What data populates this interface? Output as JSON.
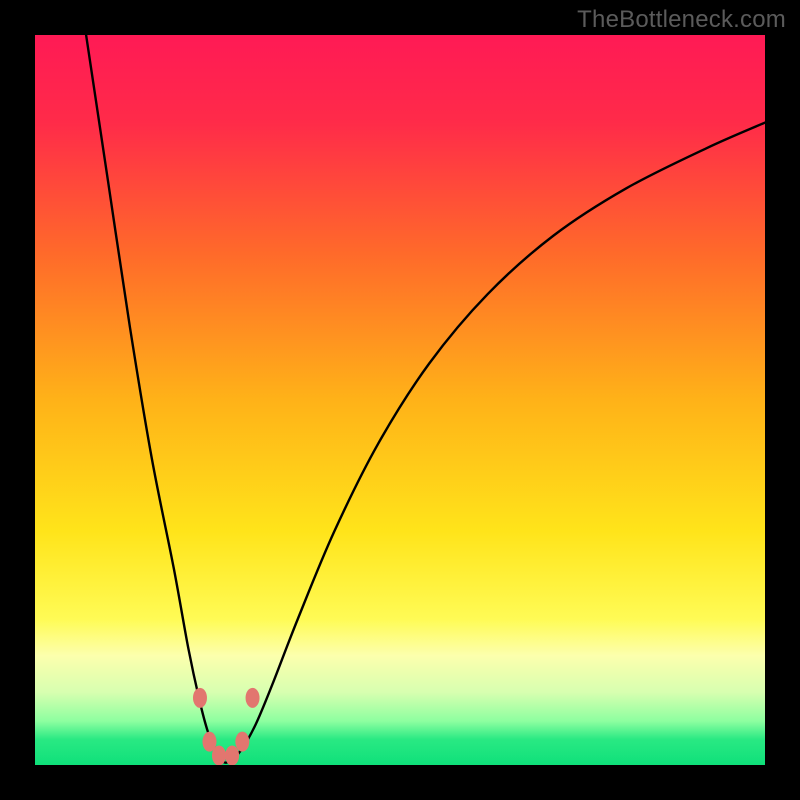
{
  "watermark": "TheBottleneck.com",
  "chart_data": {
    "type": "line",
    "title": "",
    "xlabel": "",
    "ylabel": "",
    "xlim": [
      0,
      100
    ],
    "ylim": [
      0,
      100
    ],
    "gradient_stops": [
      {
        "offset": 0.0,
        "color": "#ff1a55"
      },
      {
        "offset": 0.12,
        "color": "#ff2b49"
      },
      {
        "offset": 0.3,
        "color": "#ff6a2a"
      },
      {
        "offset": 0.5,
        "color": "#ffb218"
      },
      {
        "offset": 0.68,
        "color": "#ffe41a"
      },
      {
        "offset": 0.8,
        "color": "#fffb55"
      },
      {
        "offset": 0.85,
        "color": "#fcffad"
      },
      {
        "offset": 0.9,
        "color": "#d8ffb0"
      },
      {
        "offset": 0.94,
        "color": "#8dffa0"
      },
      {
        "offset": 0.965,
        "color": "#29e983"
      },
      {
        "offset": 1.0,
        "color": "#0fe07a"
      }
    ],
    "series": [
      {
        "name": "bottleneck-curve",
        "x": [
          7,
          10,
          13,
          16,
          19,
          21,
          22.5,
          23.7,
          24.8,
          25.7,
          26.6,
          28.2,
          30.2,
          32.5,
          36,
          41,
          47,
          54,
          62,
          71,
          81,
          92,
          100
        ],
        "y": [
          100,
          80,
          60,
          42,
          27,
          16,
          9,
          4.5,
          2.0,
          0.5,
          0.5,
          2.0,
          5.5,
          11,
          20,
          32,
          44,
          55,
          64.5,
          72.5,
          79,
          84.5,
          88
        ]
      }
    ],
    "markers": [
      {
        "x": 22.6,
        "y": 9.2
      },
      {
        "x": 23.9,
        "y": 3.2
      },
      {
        "x": 25.2,
        "y": 1.3
      },
      {
        "x": 27.0,
        "y": 1.3
      },
      {
        "x": 28.4,
        "y": 3.2
      },
      {
        "x": 29.8,
        "y": 9.2
      }
    ],
    "marker_style": {
      "color": "#e2766f",
      "rx": 7,
      "ry": 10
    }
  }
}
